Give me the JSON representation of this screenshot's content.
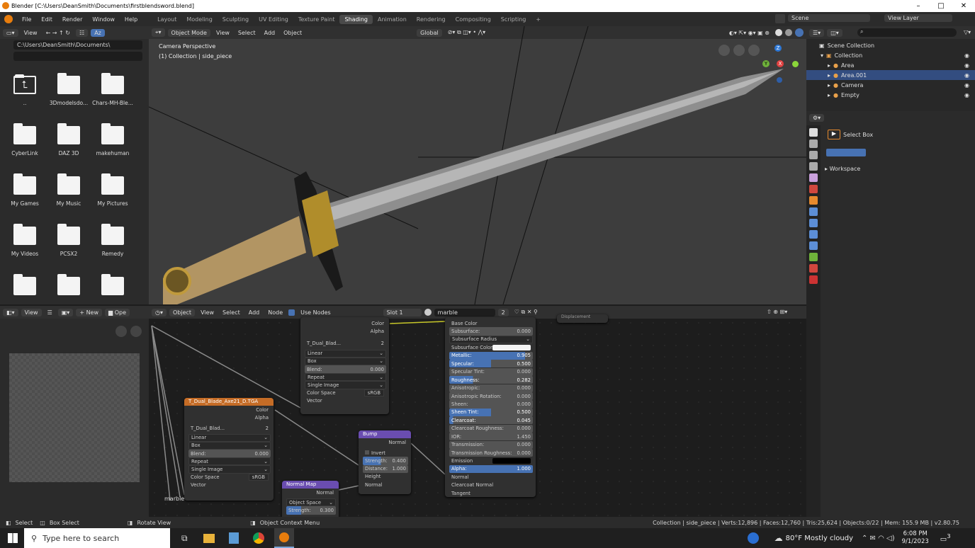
{
  "window": {
    "title": "Blender [C:\\Users\\DeanSmith\\Documents\\firstblendsword.blend]",
    "controls": [
      "–",
      "□",
      "✕"
    ]
  },
  "menus": [
    "File",
    "Edit",
    "Render",
    "Window",
    "Help"
  ],
  "workspaces": [
    "Layout",
    "Modeling",
    "Sculpting",
    "UV Editing",
    "Texture Paint",
    "Shading",
    "Animation",
    "Rendering",
    "Compositing",
    "Scripting",
    "+"
  ],
  "active_workspace": "Shading",
  "scene": {
    "name": "Scene",
    "view_layer": "View Layer"
  },
  "file_browser": {
    "view_label": "View",
    "path": "C:\\Users\\DeanSmith\\Documents\\",
    "items": [
      "..",
      "3Dmodelsdo...",
      "Chars-MH-Ble...",
      "CyberLink",
      "DAZ 3D",
      "makehuman",
      "My Games",
      "My Music",
      "My Pictures",
      "My Videos",
      "PCSX2",
      "Remedy",
      "",
      "",
      ""
    ]
  },
  "viewport": {
    "mode": "Object Mode",
    "menus": [
      "View",
      "Select",
      "Add",
      "Object"
    ],
    "transform": "Global",
    "info_line1": "Camera Perspective",
    "info_line2": "(1) Collection | side_piece",
    "gizmo": {
      "z": "Z",
      "x": "X",
      "y": "Y"
    }
  },
  "outliner": {
    "root": "Scene Collection",
    "items": [
      {
        "name": "Collection",
        "depth": 1
      },
      {
        "name": "Area",
        "depth": 2
      },
      {
        "name": "Area.001",
        "depth": 2,
        "selected": true
      },
      {
        "name": "Camera",
        "depth": 2
      },
      {
        "name": "Empty",
        "depth": 2
      }
    ]
  },
  "tool_panel": {
    "tool": "Select Box",
    "workspace": "Workspace"
  },
  "image_editor": {
    "view_label": "View",
    "new_label": "New",
    "open_label": "Ope"
  },
  "node_editor": {
    "object_label": "Object",
    "menus": [
      "View",
      "Select",
      "Add",
      "Node"
    ],
    "use_nodes": "Use Nodes",
    "slot": "Slot 1",
    "material": "marble",
    "users": "2",
    "frame_label": "marble",
    "partial_node": "Displacement"
  },
  "img_node_top": {
    "outputs": [
      "Color",
      "Alpha"
    ],
    "image": "T_Dual_Blad...",
    "users": "2",
    "interp": "Linear",
    "proj": "Box",
    "blend_label": "Blend:",
    "blend": "0.000",
    "ext": "Repeat",
    "source": "Single Image",
    "cs_label": "Color Space",
    "cs": "sRGB",
    "input": "Vector"
  },
  "img_node": {
    "title": "T_Dual_Blade_Axe21_D.TGA",
    "outputs": [
      "Color",
      "Alpha"
    ],
    "image": "T_Dual_Blad...",
    "users": "2",
    "interp": "Linear",
    "proj": "Box",
    "blend_label": "Blend:",
    "blend": "0.000",
    "ext": "Repeat",
    "source": "Single Image",
    "cs_label": "Color Space",
    "cs": "sRGB",
    "input": "Vector"
  },
  "bump": {
    "title": "Bump",
    "output": "Normal",
    "invert": "Invert",
    "strength_label": "Strength:",
    "strength": "0.400",
    "distance_label": "Distance:",
    "distance": "1.000",
    "height": "Height",
    "normal": "Normal"
  },
  "normal_map": {
    "title": "Normal Map",
    "output": "Normal",
    "space": "Object Space",
    "strength_label": "Strength:",
    "strength": "0.300"
  },
  "bsdf": {
    "rows": [
      {
        "l": "Base Color",
        "v": "",
        "t": "sock"
      },
      {
        "l": "Subsurface:",
        "v": "0.000",
        "t": "fld"
      },
      {
        "l": "Subsurface Radius",
        "v": "",
        "t": "drop"
      },
      {
        "l": "Subsurface Color",
        "v": "",
        "t": "color"
      },
      {
        "l": "Metallic:",
        "v": "0.905",
        "t": "fill",
        "f": 0.905
      },
      {
        "l": "Specular:",
        "v": "0.500",
        "t": "fill",
        "f": 0.5
      },
      {
        "l": "Specular Tint:",
        "v": "0.000",
        "t": "fld"
      },
      {
        "l": "Roughness:",
        "v": "0.282",
        "t": "fill",
        "f": 0.282
      },
      {
        "l": "Anisotropic:",
        "v": "0.000",
        "t": "fld"
      },
      {
        "l": "Anisotropic Rotation:",
        "v": "0.000",
        "t": "fld"
      },
      {
        "l": "Sheen:",
        "v": "0.000",
        "t": "fld"
      },
      {
        "l": "Sheen Tint:",
        "v": "0.500",
        "t": "fill",
        "f": 0.5
      },
      {
        "l": "Clearcoat:",
        "v": "0.045",
        "t": "fill",
        "f": 0.045
      },
      {
        "l": "Clearcoat Roughness:",
        "v": "0.000",
        "t": "fld"
      },
      {
        "l": "IOR:",
        "v": "1.450",
        "t": "fld"
      },
      {
        "l": "Transmission:",
        "v": "0.000",
        "t": "fld"
      },
      {
        "l": "Transmission Roughness:",
        "v": "0.000",
        "t": "fld"
      },
      {
        "l": "Emission",
        "v": "",
        "t": "black"
      },
      {
        "l": "Alpha:",
        "v": "1.000",
        "t": "fill",
        "f": 1.0
      },
      {
        "l": "Normal",
        "v": "",
        "t": "sock"
      },
      {
        "l": "Clearcoat Normal",
        "v": "",
        "t": "sock"
      },
      {
        "l": "Tangent",
        "v": "",
        "t": "sock"
      }
    ]
  },
  "statusbar": {
    "select": "Select",
    "box_select": "Box Select",
    "rotate": "Rotate View",
    "context": "Object Context Menu",
    "stats": "Collection | side_piece | Verts:12,896 | Faces:12,760 | Tris:25,624 | Objects:0/22 | Mem: 155.9 MB | v2.80.75"
  },
  "taskbar": {
    "search_placeholder": "Type here to search",
    "weather": "80°F  Mostly cloudy",
    "time": "6:08 PM",
    "date": "9/1/2023",
    "notif": "3"
  },
  "colors": {
    "accent": "#4772b3",
    "texture_node": "#c56c26",
    "vector_node": "#6a4db0",
    "selected_row": "#334d80"
  }
}
